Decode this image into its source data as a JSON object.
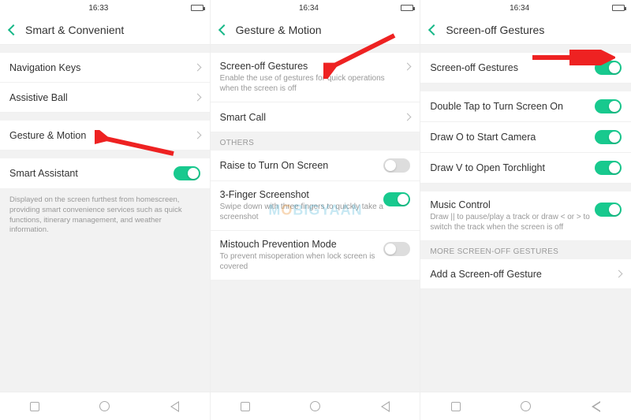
{
  "screens": [
    {
      "time": "16:33",
      "title": "Smart & Convenient",
      "rows_top": [
        {
          "label": "Navigation Keys"
        },
        {
          "label": "Assistive Ball"
        }
      ],
      "gesture_row": {
        "label": "Gesture & Motion"
      },
      "smart_assistant": {
        "label": "Smart Assistant",
        "on": true
      },
      "desc": "Displayed on the screen furthest from homescreen, providing smart convenience services such as quick functions, itinerary management, and weather information."
    },
    {
      "time": "16:34",
      "title": "Gesture & Motion",
      "screen_off": {
        "label": "Screen-off Gestures",
        "sub": "Enable the use of gestures for quick operations when the screen is off"
      },
      "smart_call": {
        "label": "Smart Call"
      },
      "others_header": "OTHERS",
      "raise": {
        "label": "Raise to Turn On Screen",
        "on": false
      },
      "three_finger": {
        "label": "3-Finger Screenshot",
        "sub": "Swipe down with three fingers to quickly take a screenshot",
        "on": true
      },
      "mistouch": {
        "label": "Mistouch Prevention Mode",
        "sub": "To prevent misoperation when lock screen is covered",
        "on": false
      }
    },
    {
      "time": "16:34",
      "title": "Screen-off Gestures",
      "main_toggle": {
        "label": "Screen-off Gestures",
        "on": true
      },
      "double_tap": {
        "label": "Double Tap to Turn Screen On",
        "on": true
      },
      "draw_o": {
        "label": "Draw O to Start Camera",
        "on": true
      },
      "draw_v": {
        "label": "Draw V to Open Torchlight",
        "on": true
      },
      "music": {
        "label": "Music Control",
        "sub": "Draw || to pause/play a track or draw < or > to switch the track when the screen is off",
        "on": true
      },
      "more_header": "MORE SCREEN-OFF GESTURES",
      "add": {
        "label": "Add a Screen-off Gesture"
      }
    }
  ],
  "watermark": "MOBIGYAAN"
}
